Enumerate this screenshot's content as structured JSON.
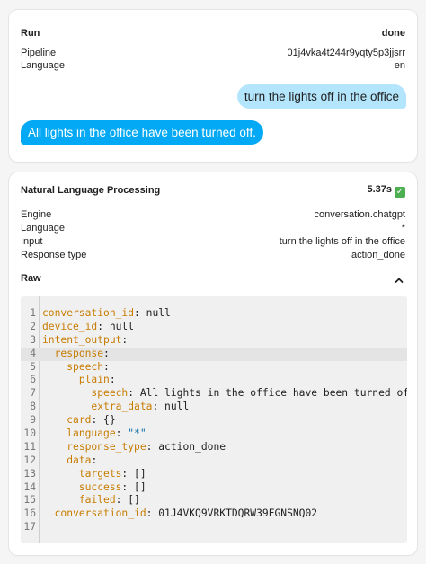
{
  "run": {
    "title": "Run",
    "status": "done",
    "pipeline_label": "Pipeline",
    "pipeline_value": "01j4vka4t244r9yqty5p3jjsrr",
    "language_label": "Language",
    "language_value": "en",
    "user_message": "turn the lights off in the office",
    "agent_message": "All lights in the office have been turned off."
  },
  "nlp": {
    "title": "Natural Language Processing",
    "duration": "5.37s",
    "status_icon": "check-icon",
    "engine_label": "Engine",
    "engine_value": "conversation.chatgpt",
    "language_label": "Language",
    "language_value": "*",
    "input_label": "Input",
    "input_value": "turn the lights off in the office",
    "response_type_label": "Response type",
    "response_type_value": "action_done",
    "raw_label": "Raw",
    "raw_expanded": true
  },
  "code": {
    "active_line": 4,
    "lines": [
      {
        "n": "1",
        "indent": "",
        "key": "conversation_id",
        "value": " null"
      },
      {
        "n": "2",
        "indent": "",
        "key": "device_id",
        "value": " null"
      },
      {
        "n": "3",
        "indent": "",
        "key": "intent_output",
        "value": ""
      },
      {
        "n": "4",
        "indent": "  ",
        "key": "response",
        "value": ""
      },
      {
        "n": "5",
        "indent": "    ",
        "key": "speech",
        "value": ""
      },
      {
        "n": "6",
        "indent": "      ",
        "key": "plain",
        "value": ""
      },
      {
        "n": "7",
        "indent": "        ",
        "key": "speech",
        "value": " All lights in the office have been turned off."
      },
      {
        "n": "8",
        "indent": "        ",
        "key": "extra_data",
        "value": " null"
      },
      {
        "n": "9",
        "indent": "    ",
        "key": "card",
        "value": " {}"
      },
      {
        "n": "10",
        "indent": "    ",
        "key": "language",
        "value": " \"*\"",
        "string": true
      },
      {
        "n": "11",
        "indent": "    ",
        "key": "response_type",
        "value": " action_done"
      },
      {
        "n": "12",
        "indent": "    ",
        "key": "data",
        "value": ""
      },
      {
        "n": "13",
        "indent": "      ",
        "key": "targets",
        "value": " []"
      },
      {
        "n": "14",
        "indent": "      ",
        "key": "success",
        "value": " []"
      },
      {
        "n": "15",
        "indent": "      ",
        "key": "failed",
        "value": " []"
      },
      {
        "n": "16",
        "indent": "  ",
        "key": "conversation_id",
        "value": " 01J4VKQ9VRKTDQRW39FGNSNQ02"
      },
      {
        "n": "17",
        "indent": "",
        "key": "",
        "value": ""
      }
    ]
  }
}
